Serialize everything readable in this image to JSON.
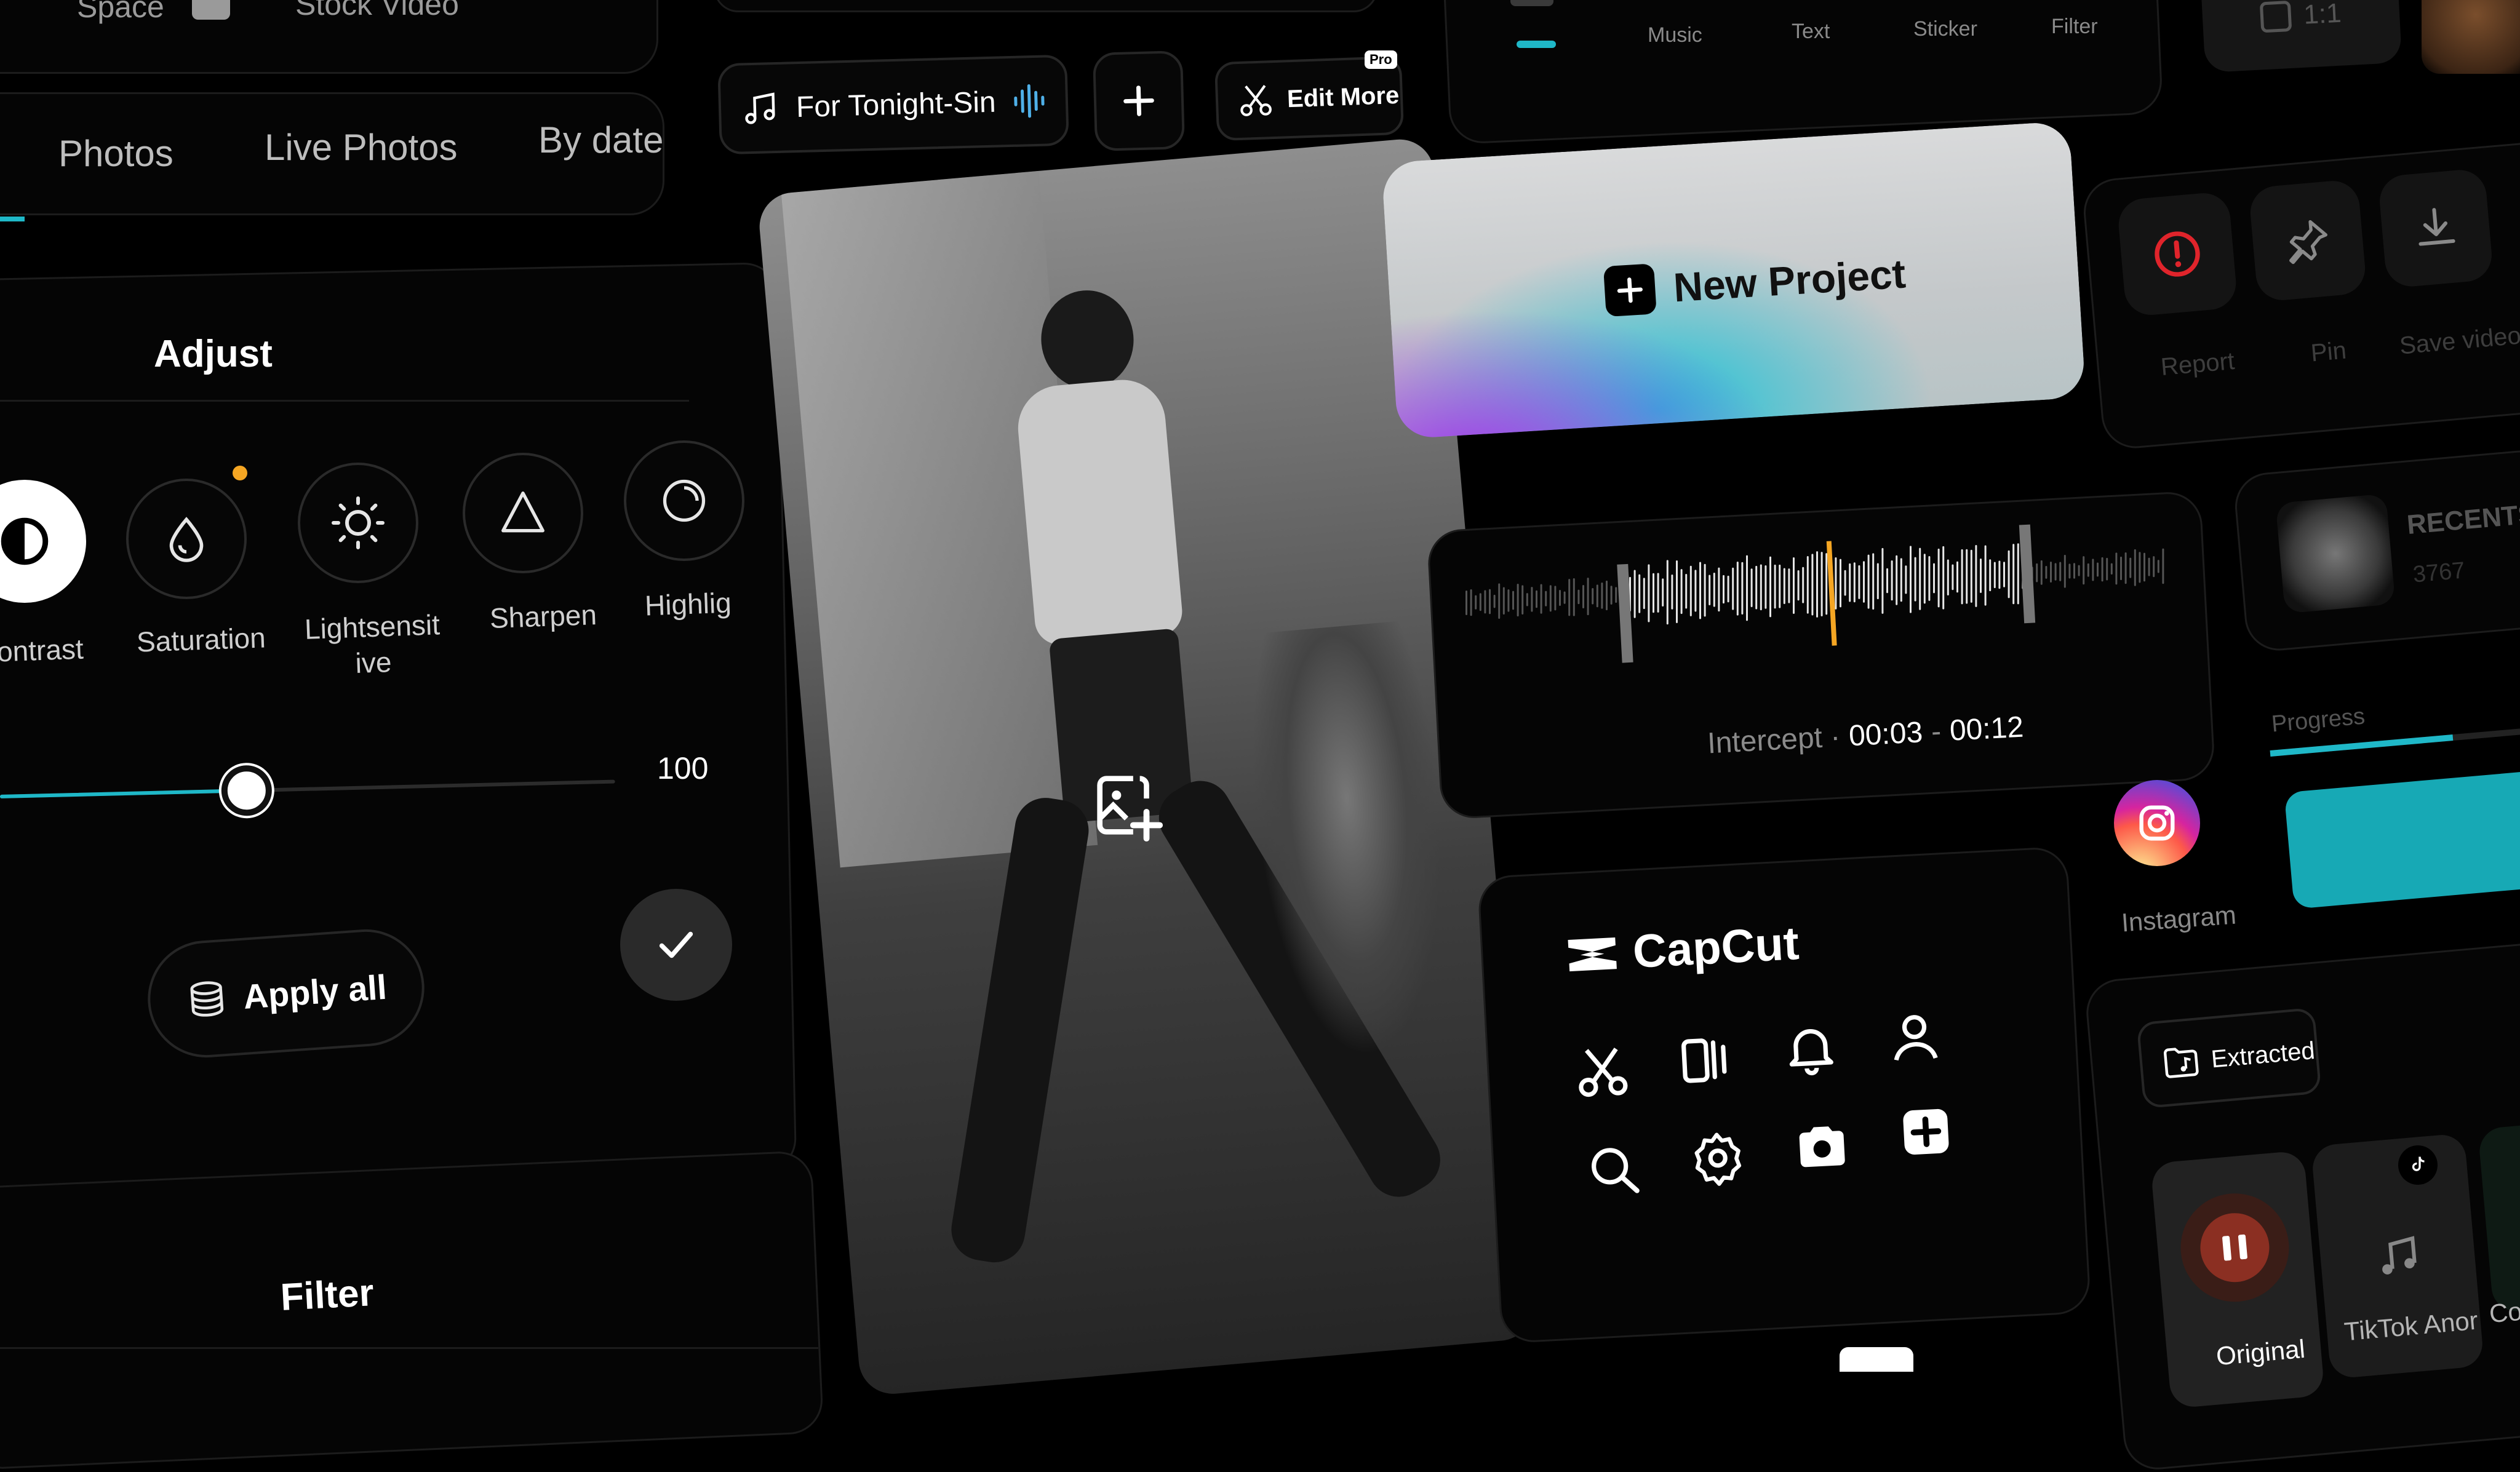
{
  "top_left": {
    "space_label": "Space",
    "stock_video_label": "Stock Video"
  },
  "media_tabs": [
    "Photos",
    "Live Photos",
    "By date"
  ],
  "adjust": {
    "title": "Adjust",
    "tools": [
      "ontrast",
      "Saturation",
      "Lightsensit\nive",
      "Sharpen",
      "Highlig"
    ],
    "slider_value": "100",
    "slider_fraction": 0.38,
    "apply_all_label": "Apply all",
    "filter_label": "Filter"
  },
  "toolbar": {
    "song_label": "For Tonight-Sin",
    "edit_more_label": "Edit More",
    "pro_badge": "Pro"
  },
  "top_tabs": [
    "Music",
    "Text",
    "Sticker",
    "Filter"
  ],
  "aspect_label": "1:1",
  "new_project": {
    "label": "New Project"
  },
  "waveform": {
    "intercept_label": "Intercept ·",
    "start_time": "00:03",
    "separator": "-",
    "end_time": "00:12"
  },
  "actions": [
    "Report",
    "Pin",
    "Save video"
  ],
  "recents": {
    "label": "RECENTS",
    "count": "3767"
  },
  "progress": {
    "label": "Progress",
    "fraction": 0.62
  },
  "capcut": {
    "brand": "CapCut"
  },
  "instagram": {
    "label": "Instagram"
  },
  "extracted": {
    "label": "Extracted"
  },
  "sounds": [
    "Original",
    "TikTok Anor",
    "Co"
  ],
  "colors": {
    "accent": "#1fb8c8",
    "orange": "#f5a623",
    "progress_fill": "#17a9b5",
    "pause_red": "#8b2f22",
    "report_red": "#e0242b"
  }
}
